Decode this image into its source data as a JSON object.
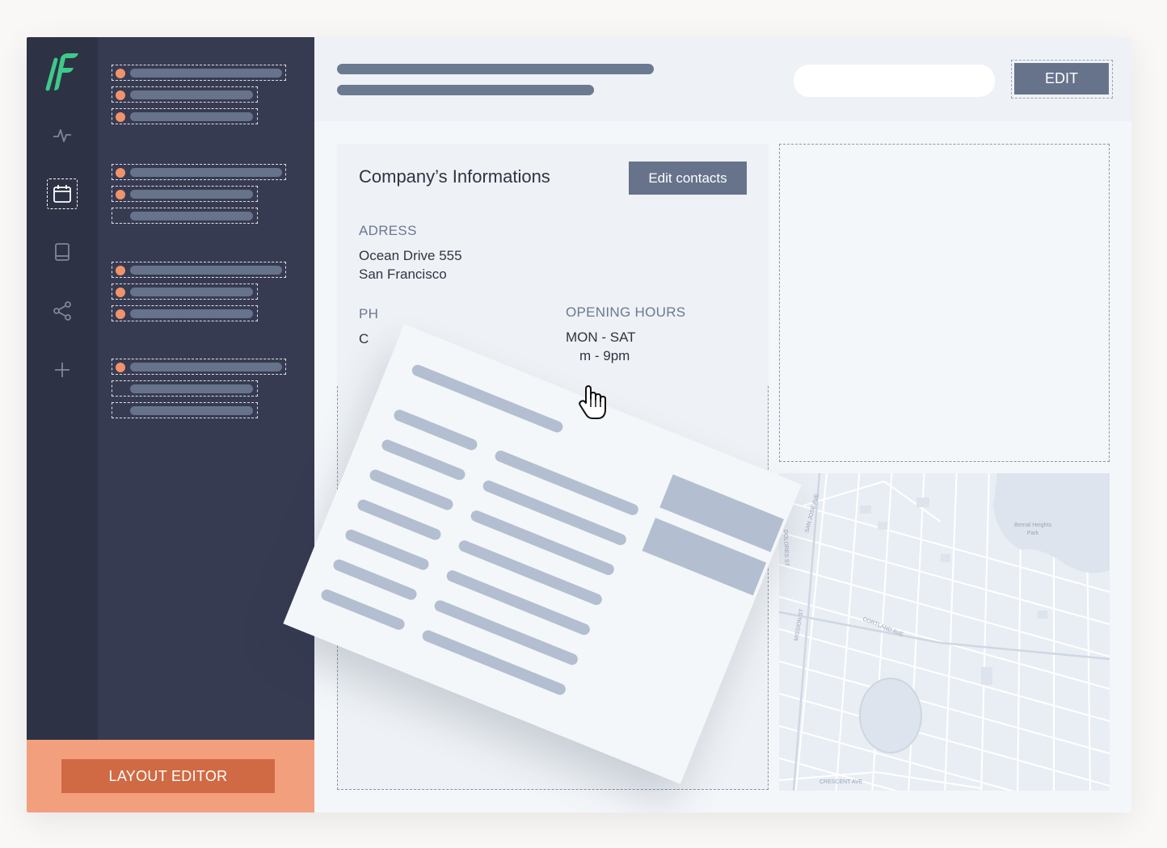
{
  "header": {
    "edit_label": "EDIT"
  },
  "footer": {
    "layout_editor_label": "LAYOUT EDITOR"
  },
  "company": {
    "title": "Company’s Informations",
    "edit_contacts_label": "Edit contacts",
    "address_label": "ADRESS",
    "address_line1": "Ocean Drive 555",
    "address_line2": "San Francisco",
    "phone_label_partial": "PH",
    "phone_value_partial": "C",
    "hours_label": "OPENING HOURS",
    "hours_days": "MON - SAT",
    "hours_time_partial": "m - 9pm"
  },
  "map": {
    "labels": {
      "park": "Bernal Heights",
      "park2": "Park",
      "dolores": "DOLORES ST",
      "sanjose": "SAN JOSE AVE",
      "mission": "MISSION ST",
      "cortland": "CORTLAND AVE",
      "crescent": "CRESCENT AVE"
    }
  },
  "icons": {
    "rail": [
      "activity-icon",
      "calendar-icon",
      "book-icon",
      "share-icon",
      "plus-icon"
    ]
  },
  "colors": {
    "rail_bg": "#2d3244",
    "tree_bg": "#373b52",
    "accent_orange": "#f0936b",
    "footer_bg": "#f29f7d",
    "button_dark": "#66738b",
    "logo_green": "#3ec98a"
  }
}
